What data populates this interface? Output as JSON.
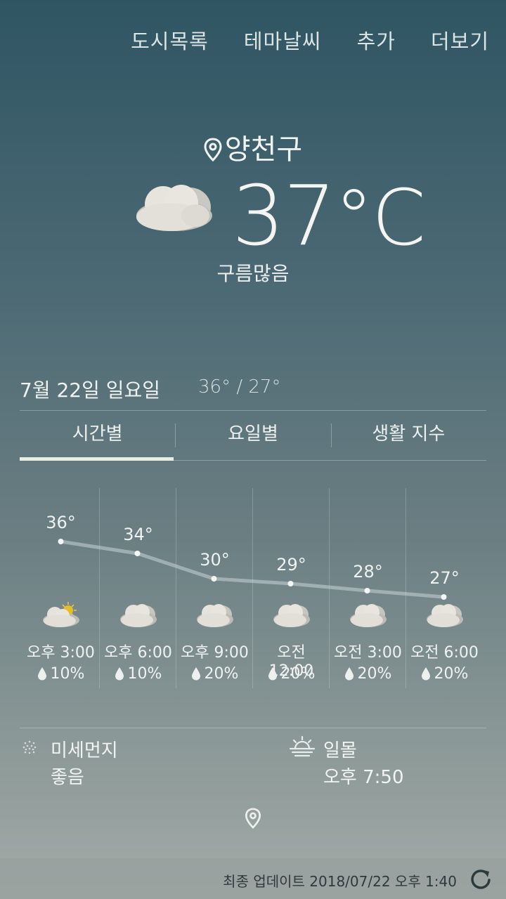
{
  "menu": {
    "cities": "도시목록",
    "theme": "테마날씨",
    "add": "추가",
    "more": "더보기"
  },
  "location": "양천구",
  "current": {
    "temp": "37",
    "unit": "°C",
    "condition": "구름많음",
    "icon": "cloudy-icon"
  },
  "today": {
    "date": "7월 22일 일요일",
    "hilo": "36° / 27°"
  },
  "tabs": [
    "시간별",
    "요일별",
    "생활 지수"
  ],
  "hourly": [
    {
      "temp": "36°",
      "time": "오후 3:00",
      "rain": "10%",
      "icon": "partly-sunny-icon"
    },
    {
      "temp": "34°",
      "time": "오후 6:00",
      "rain": "10%",
      "icon": "cloudy-icon"
    },
    {
      "temp": "30°",
      "time": "오후 9:00",
      "rain": "20%",
      "icon": "cloudy-icon"
    },
    {
      "temp": "29°",
      "time": "오전 12:00",
      "rain": "20%",
      "icon": "cloudy-icon"
    },
    {
      "temp": "28°",
      "time": "오전 3:00",
      "rain": "20%",
      "icon": "cloudy-icon"
    },
    {
      "temp": "27°",
      "time": "오전 6:00",
      "rain": "20%",
      "icon": "cloudy-icon"
    }
  ],
  "dust": {
    "label": "미세먼지",
    "value": "좋음"
  },
  "sunset": {
    "label": "일몰",
    "value": "오후 7:50"
  },
  "footer": {
    "updated": "최종 업데이트  2018/07/22  오후 1:40"
  }
}
